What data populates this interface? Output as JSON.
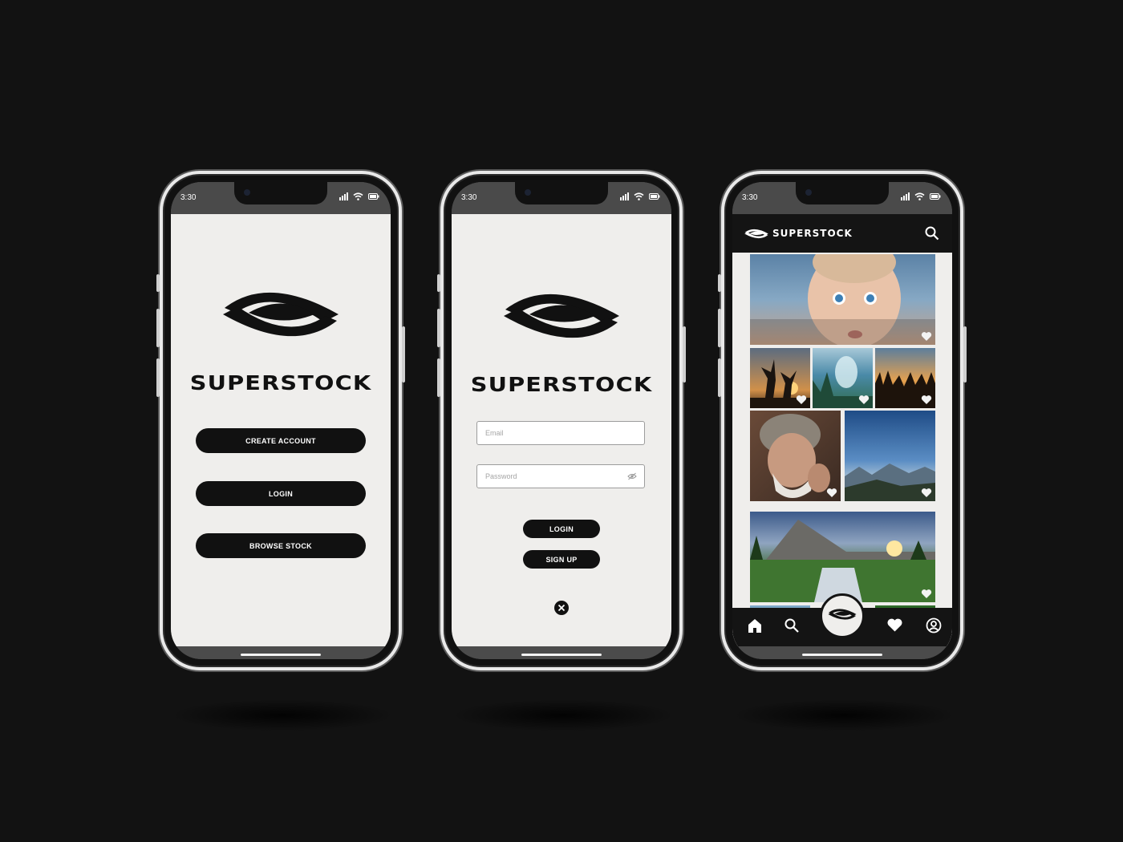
{
  "status_bar": {
    "time": "3:30"
  },
  "brand": {
    "name": "SUPERSTOCK",
    "logo_icon": "eye-logo-icon"
  },
  "welcome_screen": {
    "buttons": {
      "create_account": "CREATE ACCOUNT",
      "login": "LOGIN",
      "browse_stock": "BROWSE STOCK"
    }
  },
  "login_screen": {
    "email_placeholder": "Email",
    "password_placeholder": "Password",
    "password_toggle_icon": "eye-off-icon",
    "login_label": "LOGIN",
    "signup_label": "SIGN UP",
    "close_icon": "close-icon"
  },
  "gallery_screen": {
    "header_title": "SUPERSTOCK",
    "search_icon": "search-icon",
    "tiles": [
      {
        "name": "photo-baby-face",
        "subject": "baby face"
      },
      {
        "name": "photo-dancers-sunset",
        "subject": "dancers at sunset"
      },
      {
        "name": "photo-fantasy-forest",
        "subject": "fantasy forest"
      },
      {
        "name": "photo-crowd-concert",
        "subject": "crowd at concert"
      },
      {
        "name": "photo-old-man",
        "subject": "old man portrait"
      },
      {
        "name": "photo-mountain-sky",
        "subject": "mountain sky"
      },
      {
        "name": "photo-mountain-waterfall",
        "subject": "mountain waterfall"
      }
    ],
    "nav": [
      "home-icon",
      "search-icon",
      "eye-logo-icon",
      "heart-icon",
      "profile-icon"
    ]
  },
  "colors": {
    "background": "#121212",
    "screen": "#efeeec",
    "primary": "#111111",
    "accent": "#ffffff"
  }
}
